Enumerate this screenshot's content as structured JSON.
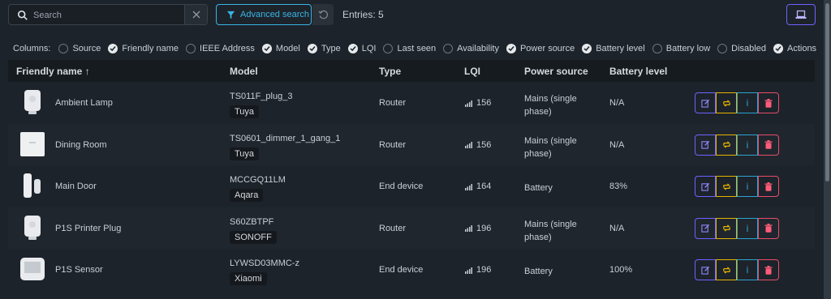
{
  "toolbar": {
    "search_placeholder": "Search",
    "advanced_label": "Advanced search",
    "entries_label": "Entries: 5"
  },
  "columns": {
    "label": "Columns:",
    "items": [
      {
        "label": "Source",
        "checked": false
      },
      {
        "label": "Friendly name",
        "checked": true
      },
      {
        "label": "IEEE Address",
        "checked": false
      },
      {
        "label": "Model",
        "checked": true
      },
      {
        "label": "Type",
        "checked": true
      },
      {
        "label": "LQI",
        "checked": true
      },
      {
        "label": "Last seen",
        "checked": false
      },
      {
        "label": "Availability",
        "checked": false
      },
      {
        "label": "Power source",
        "checked": true
      },
      {
        "label": "Battery level",
        "checked": true
      },
      {
        "label": "Battery low",
        "checked": false
      },
      {
        "label": "Disabled",
        "checked": false
      },
      {
        "label": "Actions",
        "checked": true
      }
    ]
  },
  "table": {
    "headers": {
      "friendly_name": "Friendly name ↑",
      "model": "Model",
      "type": "Type",
      "lqi": "LQI",
      "power": "Power source",
      "battery": "Battery level"
    },
    "rows": [
      {
        "name": "Ambient Lamp",
        "model": "TS011F_plug_3",
        "vendor": "Tuya",
        "type": "Router",
        "lqi": "156",
        "power": "Mains (single",
        "power2": "phase)",
        "battery": "N/A",
        "icon": "smart-plug-icon"
      },
      {
        "name": "Dining Room",
        "model": "TS0601_dimmer_1_gang_1",
        "vendor": "Tuya",
        "type": "Router",
        "lqi": "156",
        "power": "Mains (single",
        "power2": "phase)",
        "battery": "N/A",
        "icon": "wall-switch-icon"
      },
      {
        "name": "Main Door",
        "model": "MCCGQ11LM",
        "vendor": "Aqara",
        "type": "End device",
        "lqi": "164",
        "power": "Battery",
        "power2": "",
        "battery": "83%",
        "icon": "door-sensor-icon"
      },
      {
        "name": "P1S Printer Plug",
        "model": "S60ZBTPF",
        "vendor": "SONOFF",
        "type": "Router",
        "lqi": "196",
        "power": "Mains (single",
        "power2": "phase)",
        "battery": "N/A",
        "icon": "smart-plug-icon"
      },
      {
        "name": "P1S Sensor",
        "model": "LYWSD03MMC-z",
        "vendor": "Xiaomi",
        "type": "End device",
        "lqi": "196",
        "power": "Battery",
        "power2": "",
        "battery": "100%",
        "icon": "temperature-sensor-icon"
      }
    ]
  },
  "colors": {
    "accent_blue": "#3ab4e6",
    "edit": "#6c63ff",
    "swap": "#e6b400",
    "info": "#2aa4d4",
    "delete": "#e44d6b"
  }
}
